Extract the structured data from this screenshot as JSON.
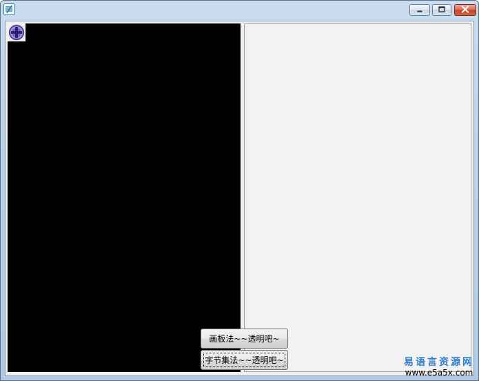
{
  "window": {
    "title": "",
    "controls": {
      "minimize_icon": "minimize-icon",
      "maximize_icon": "maximize-icon",
      "close_icon": "close-icon"
    },
    "accent_close": "#d9694f"
  },
  "canvas": {
    "background": "#000000",
    "icon": "circle-plus-icon",
    "icon_color": "#5b3fa8"
  },
  "buttons": {
    "canvas_method_label": "画板法~~透明吧~",
    "byteset_method_label": "字节集法~~透明吧~"
  },
  "watermark": {
    "chinese": "易语言资源网",
    "url": "www.e5a5x.com"
  }
}
